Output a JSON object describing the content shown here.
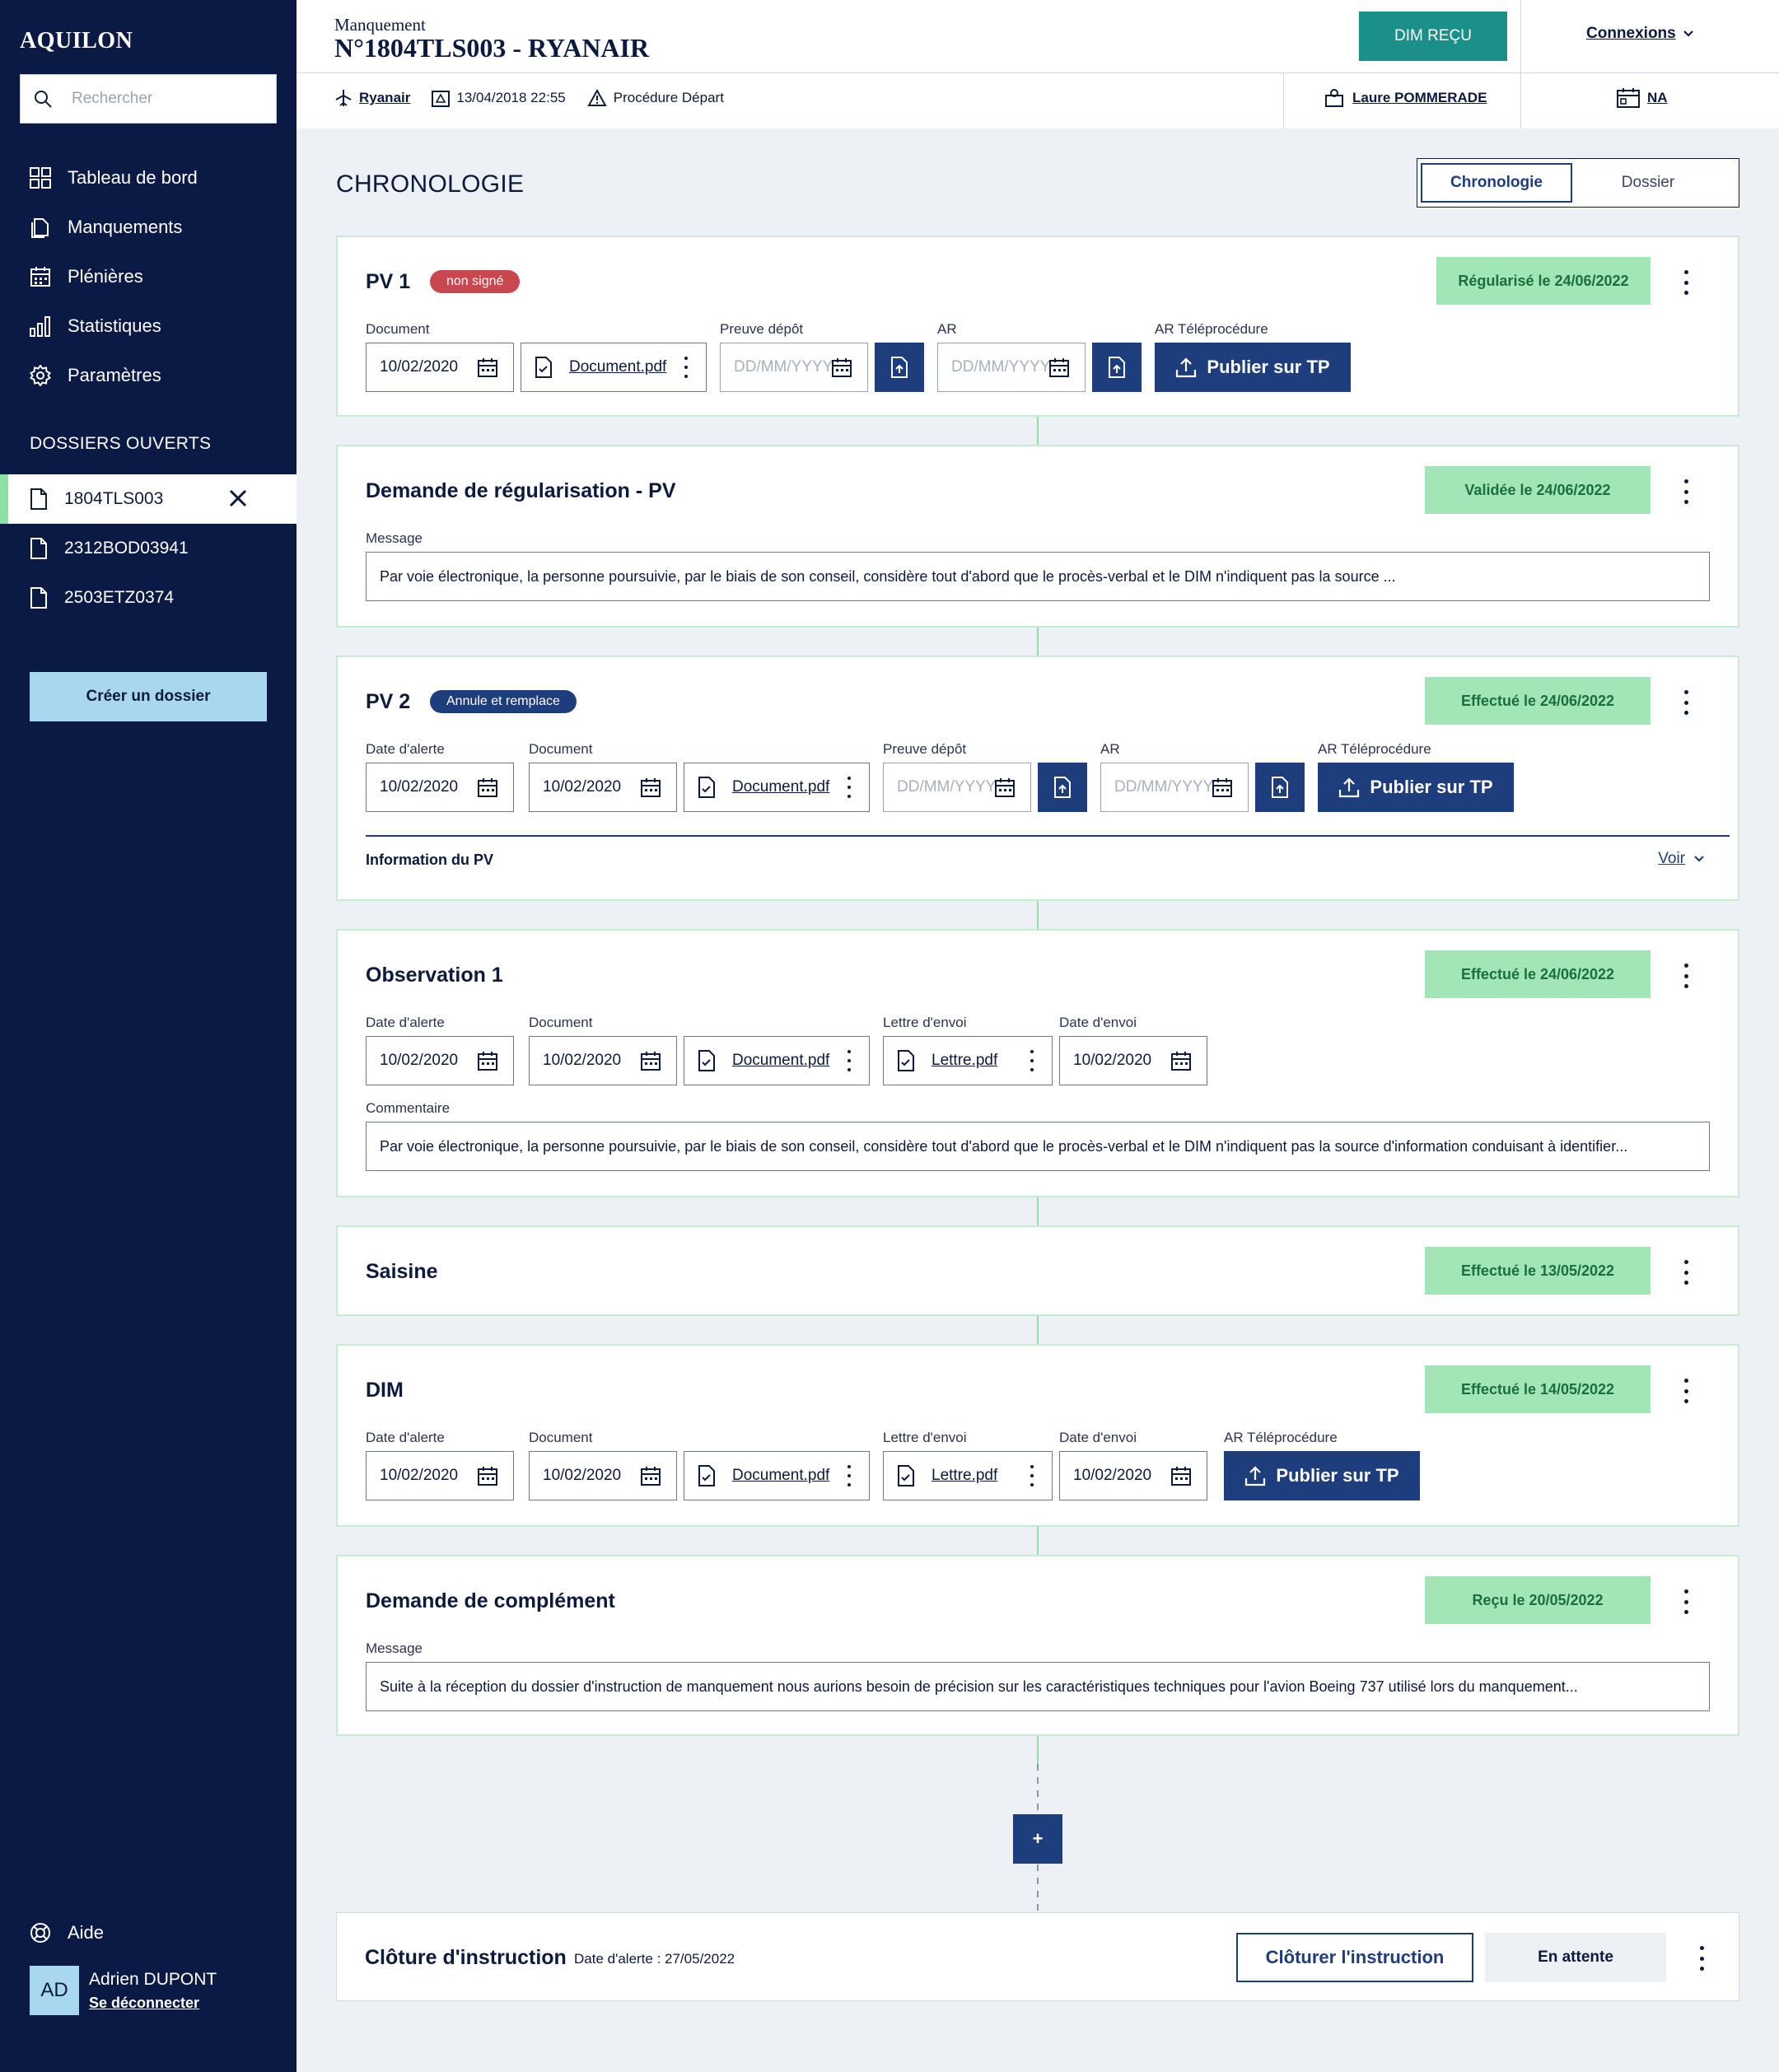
{
  "sidebar": {
    "brand": "AQUILON",
    "search_placeholder": "Rechercher",
    "nav": [
      {
        "label": "Tableau de bord",
        "icon": "dashboard-icon"
      },
      {
        "label": "Manquements",
        "icon": "documents-icon"
      },
      {
        "label": "Plénières",
        "icon": "calendar-icon"
      },
      {
        "label": "Statistiques",
        "icon": "bar-chart-icon"
      },
      {
        "label": "Paramètres",
        "icon": "gear-icon"
      }
    ],
    "section_title": "DOSSIERS OUVERTS",
    "dossiers": [
      {
        "label": "1804TLS003",
        "active": true
      },
      {
        "label": "2312BOD03941",
        "active": false
      },
      {
        "label": "2503ETZ0374",
        "active": false
      }
    ],
    "create_label": "Créer un dossier",
    "help_label": "Aide",
    "user": {
      "initials": "AD",
      "name": "Adrien DUPONT",
      "logout": "Se déconnecter"
    }
  },
  "header": {
    "subtitle": "Manquement",
    "title": "N°1804TLS003  - RYANAIR",
    "dim_button": "DIM REÇU",
    "connexions": "Connexions",
    "company": "Ryanair",
    "datetime": "13/04/2018 22:55",
    "procedure": "Procédure Départ",
    "inspector": "Laure POMMERADE",
    "na": "NA"
  },
  "main": {
    "title": "CHRONOLOGIE",
    "tabs": [
      {
        "label": "Chronologie",
        "active": true
      },
      {
        "label": "Dossier",
        "active": false
      }
    ]
  },
  "cards": {
    "pv1": {
      "title": "PV 1",
      "badge": "non signé",
      "status": "Régularisé le 24/06/2022",
      "lbl_document": "Document",
      "lbl_preuve": "Preuve dépôt",
      "lbl_ar": "AR",
      "lbl_artp": "AR Téléprocédure",
      "date": "10/02/2020",
      "doc": "Document.pdf",
      "placeholder": "DD/MM/YYYY",
      "publish": "Publier sur TP"
    },
    "demande": {
      "title": "Demande de régularisation - PV",
      "status": "Validée le 24/06/2022",
      "lbl_message": "Message",
      "message": "Par voie électronique, la personne poursuivie, par le biais de son conseil, considère tout d'abord que le procès-verbal et le DIM n'indiquent pas la source ..."
    },
    "pv2": {
      "title": "PV 2",
      "badge": "Annule et remplace",
      "status": "Effectué le 24/06/2022",
      "lbl_alerte": "Date d'alerte",
      "lbl_document": "Document",
      "lbl_preuve": "Preuve dépôt",
      "lbl_ar": "AR",
      "lbl_artp": "AR Téléprocédure",
      "date_alerte": "10/02/2020",
      "date_doc": "10/02/2020",
      "doc": "Document.pdf",
      "placeholder": "DD/MM/YYYY",
      "publish": "Publier sur TP",
      "info": "Information du PV",
      "voir": "Voir"
    },
    "obs": {
      "title": "Observation 1",
      "status": "Effectué le 24/06/2022",
      "lbl_alerte": "Date d'alerte",
      "lbl_document": "Document",
      "lbl_lettre": "Lettre d'envoi",
      "lbl_envoi": "Date d'envoi",
      "lbl_comment": "Commentaire",
      "date_alerte": "10/02/2020",
      "date_doc": "10/02/2020",
      "doc": "Document.pdf",
      "lettre": "Lettre.pdf",
      "date_envoi": "10/02/2020",
      "comment": "Par voie électronique, la personne poursuivie, par le biais de son conseil, considère tout d'abord que le procès-verbal et le DIM n'indiquent pas la source d'information conduisant à identifier..."
    },
    "saisine": {
      "title": "Saisine",
      "status": "Effectué le 13/05/2022"
    },
    "dim": {
      "title": "DIM",
      "status": "Effectué le 14/05/2022",
      "lbl_alerte": "Date d'alerte",
      "lbl_document": "Document",
      "lbl_lettre": "Lettre d'envoi",
      "lbl_envoi": "Date d'envoi",
      "lbl_artp": "AR Téléprocédure",
      "date_alerte": "10/02/2020",
      "date_doc": "10/02/2020",
      "doc": "Document.pdf",
      "lettre": "Lettre.pdf",
      "date_envoi": "10/02/2020",
      "publish": "Publier sur TP"
    },
    "complement": {
      "title": "Demande de complément",
      "status": "Reçu le 20/05/2022",
      "lbl_message": "Message",
      "message": "Suite à la réception du dossier d'instruction de manquement nous aurions besoin de précision sur les caractéristiques techniques pour l'avion Boeing 737 utilisé lors du manquement..."
    }
  },
  "add_label": "+",
  "closure": {
    "title": "Clôture d'instruction",
    "alert": "Date d'alerte : 27/05/2022",
    "button": "Clôturer l'instruction",
    "status": "En attente"
  }
}
